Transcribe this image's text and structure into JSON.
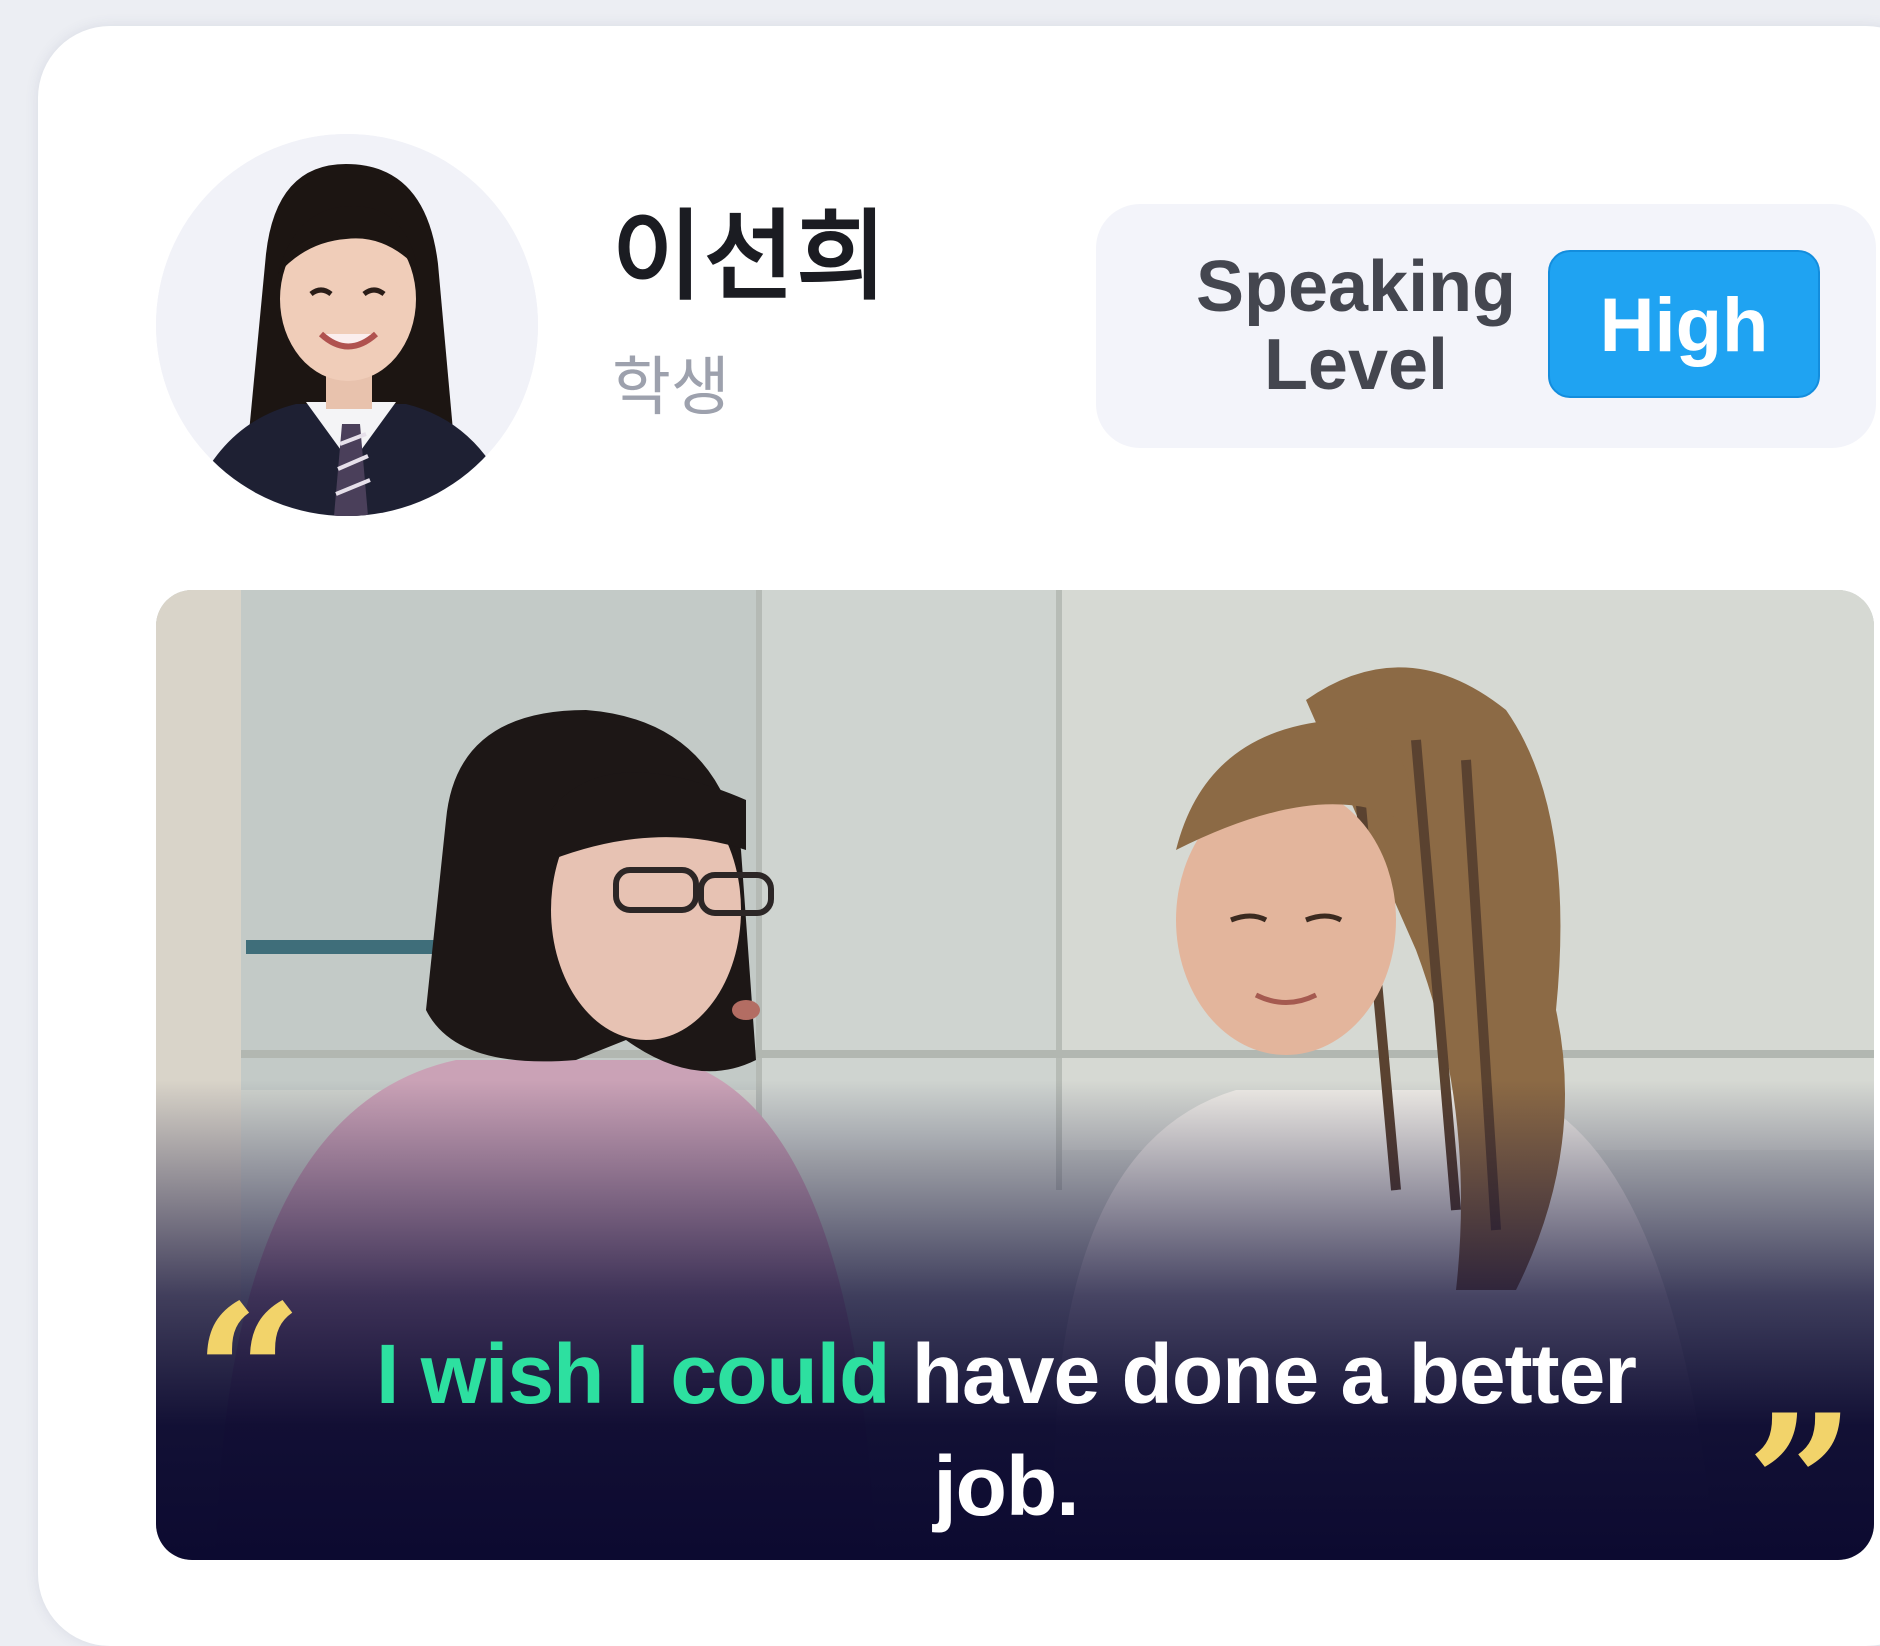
{
  "profile": {
    "name": "이선희",
    "role": "학생",
    "avatar_icon": "student-portrait"
  },
  "speaking_level": {
    "label": "Speaking Level",
    "value": "High",
    "badge_color": "#1fa3f2"
  },
  "scene": {
    "image_icon": "two-women-conversation-photo",
    "quote_open_icon": "open-quote-icon",
    "quote_close_icon": "close-quote-icon",
    "caption_highlight": "I wish I could",
    "caption_rest": "have done a better job.",
    "highlight_color": "#2de0a0",
    "quote_color": "#f2d36a"
  }
}
